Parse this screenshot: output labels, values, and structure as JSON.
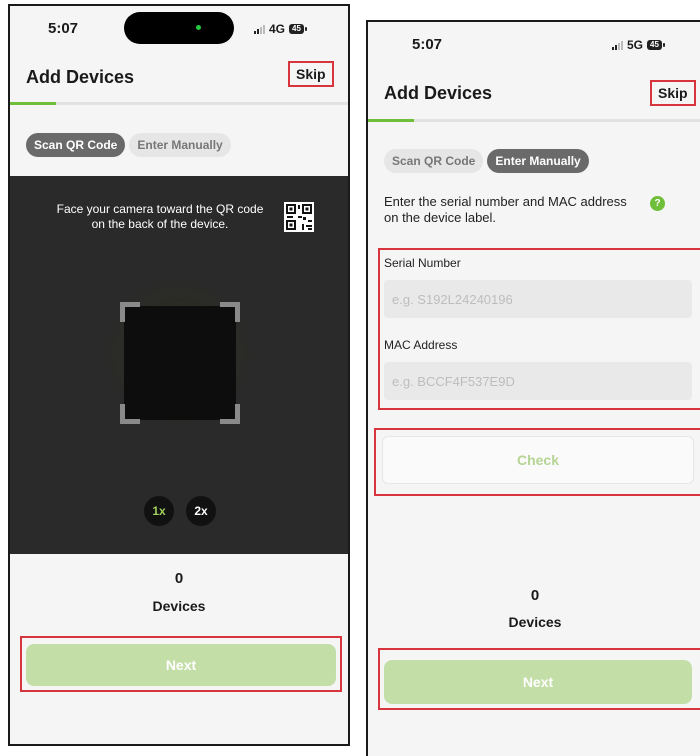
{
  "left": {
    "status": {
      "time": "5:07",
      "network": "4G",
      "battery": "45"
    },
    "header": {
      "title": "Add Devices",
      "skip_label": "Skip"
    },
    "tabs": {
      "scan_label": "Scan QR Code",
      "manual_label": "Enter Manually",
      "active": "scan"
    },
    "camera": {
      "instruction": "Face your camera toward the QR code on the back of the device.",
      "zoom_options": [
        "1x",
        "2x"
      ],
      "selected_zoom": "1x"
    },
    "devices": {
      "count": "0",
      "label": "Devices"
    },
    "next_label": "Next",
    "progress_fraction": 0.15
  },
  "right": {
    "status": {
      "time": "5:07",
      "network": "5G",
      "battery": "45"
    },
    "header": {
      "title": "Add Devices",
      "skip_label": "Skip"
    },
    "tabs": {
      "scan_label": "Scan QR Code",
      "manual_label": "Enter Manually",
      "active": "manual"
    },
    "instructions": "Enter the serial number and MAC address on the device label.",
    "help_icon_glyph": "?",
    "serial": {
      "label": "Serial Number",
      "placeholder": "e.g. S192L24240196"
    },
    "mac": {
      "label": "MAC Address",
      "placeholder": "e.g. BCCF4F537E9D"
    },
    "check_label": "Check",
    "devices": {
      "count": "0",
      "label": "Devices"
    },
    "next_label": "Next",
    "progress_fraction": 0.15
  },
  "colors": {
    "accent_green": "#6fbf3a",
    "next_button_disabled": "#c4dea8",
    "highlight_red": "#d7343e",
    "zoom_selected": "#9fd05a"
  },
  "icons": [
    "signal-icon",
    "battery-icon",
    "qr-code-icon",
    "help-icon"
  ]
}
